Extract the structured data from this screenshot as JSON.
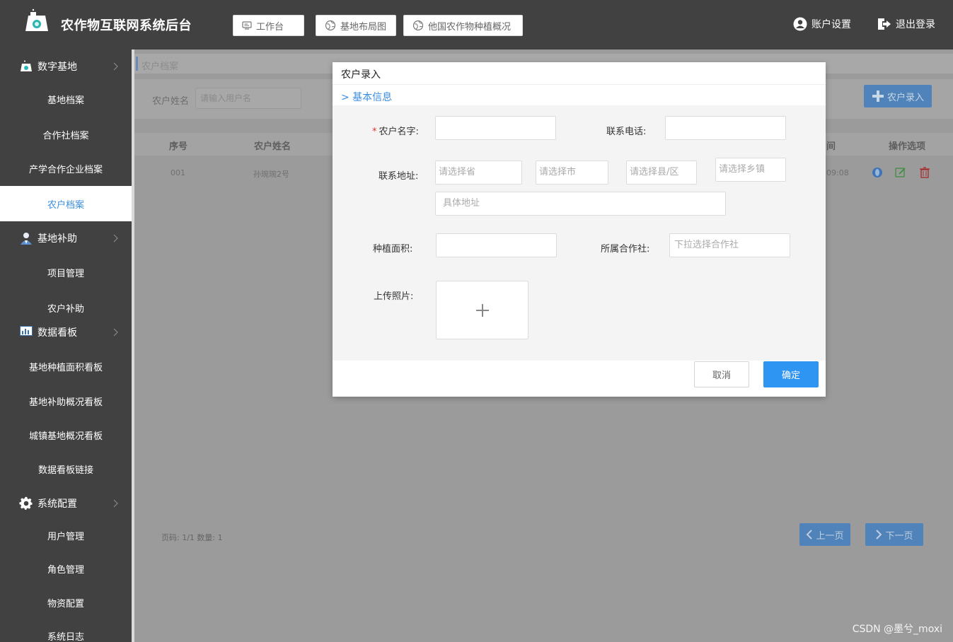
{
  "header": {
    "title": "农作物互联网系统后台",
    "nav": [
      {
        "label": "工作台",
        "icon": "monitor-icon"
      },
      {
        "label": "基地布局图",
        "icon": "globe-icon"
      },
      {
        "label": "他国农作物种植概况",
        "icon": "globe-icon"
      }
    ],
    "account_label": "账户设置",
    "logout_label": "退出登录"
  },
  "sidebar": {
    "digital_base": {
      "label": "数字基地",
      "icon": "flask-icon",
      "items": [
        "基地档案",
        "合作社档案",
        "产学合作企业档案",
        "农户档案"
      ]
    },
    "subsidy": {
      "label": "基地补助",
      "icon": "person-icon",
      "items": [
        "项目管理",
        "农户补助"
      ]
    },
    "dashboard": {
      "label": "数据看板",
      "icon": "bar-chart-icon",
      "items": [
        "基地种植面积看板",
        "基地补助概况看板",
        "城镇基地概况看板",
        "数据看板链接"
      ]
    },
    "system": {
      "label": "系统配置",
      "icon": "gear-icon",
      "items": [
        "用户管理",
        "角色管理",
        "物资配置",
        "系统日志"
      ]
    },
    "active_item": "农户档案"
  },
  "main": {
    "breadcrumb": "农户档案",
    "search": {
      "label": "农户姓名",
      "placeholder": "请输入用户名"
    },
    "add_button": "农户录入",
    "table": {
      "columns": [
        "序号",
        "农户姓名",
        "间",
        "操作选项"
      ],
      "rows": [
        {
          "index": "001",
          "name": "孙琬琬2号",
          "time": "09:08"
        }
      ]
    },
    "pager": {
      "info": "页码: 1/1 数量: 1",
      "prev": "上一页",
      "next": "下一页"
    }
  },
  "modal": {
    "title": "农户录入",
    "section": "> 基本信息",
    "fields": {
      "name_label": "农户名字:",
      "phone_label": "联系电话:",
      "address_label": "联系地址:",
      "province_placeholder": "请选择省",
      "city_placeholder": "请选择市",
      "county_placeholder": "请选择县/区",
      "town_placeholder": "请选择乡镇",
      "detail_placeholder": "具体地址",
      "area_label": "种植面积:",
      "coop_label": "所属合作社:",
      "coop_placeholder": "下拉选择合作社",
      "photo_label": "上传照片:"
    },
    "cancel": "取消",
    "confirm": "确定"
  },
  "watermark": "CSDN @墨兮_moxi"
}
